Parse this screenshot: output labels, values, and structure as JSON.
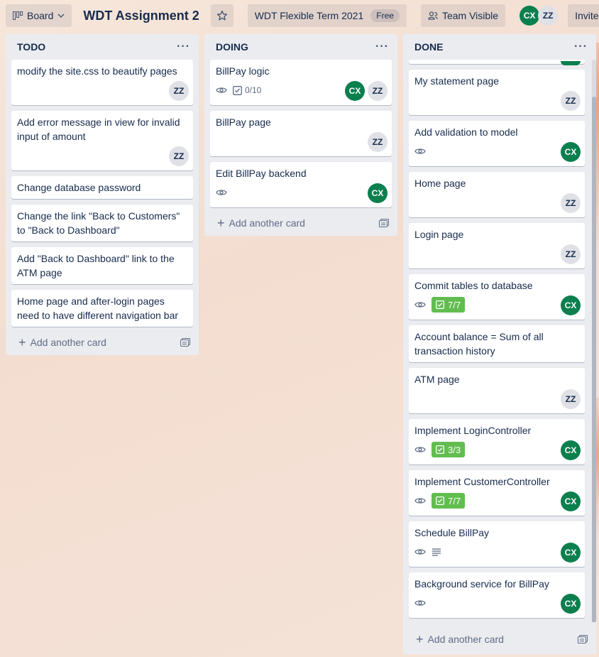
{
  "header": {
    "board_menu_label": "Board",
    "title": "WDT Assignment 2",
    "workspace_label": "WDT Flexible Term 2021",
    "plan_badge": "Free",
    "visibility_label": "Team Visible",
    "members": [
      "CX",
      "ZZ"
    ],
    "invite_label": "Invite"
  },
  "lists": [
    {
      "name": "TODO",
      "add_card_label": "Add another card",
      "cards": [
        {
          "title": "modify the site.css to beautify pages",
          "members": [
            "ZZ"
          ]
        },
        {
          "title": "Add error message in view for invalid input of amount",
          "members": [
            "ZZ"
          ]
        },
        {
          "title": "Change database password",
          "members": []
        },
        {
          "title": "Change the link \"Back to Customers\" to \"Back to Dashboard\"",
          "members": []
        },
        {
          "title": "Add \"Back to Dashboard\" link to the ATM page",
          "members": []
        },
        {
          "title": "Home page and after-login pages need to have different navigation bar",
          "members": []
        }
      ]
    },
    {
      "name": "DOING",
      "add_card_label": "Add another card",
      "cards": [
        {
          "title": "BillPay logic",
          "watch": true,
          "checklist": "0/10",
          "members": [
            "CX",
            "ZZ"
          ]
        },
        {
          "title": "BillPay page",
          "members": [
            "ZZ"
          ]
        },
        {
          "title": "Edit BillPay backend",
          "watch": true,
          "members": [
            "CX"
          ]
        }
      ]
    },
    {
      "name": "DONE",
      "add_card_label": "Add another card",
      "cards": [
        {
          "title": "My statement page",
          "members": [
            "ZZ"
          ]
        },
        {
          "title": "Add validation to model",
          "watch": true,
          "members": [
            "CX"
          ]
        },
        {
          "title": "Home page",
          "members": [
            "ZZ"
          ]
        },
        {
          "title": "Login page",
          "members": [
            "ZZ"
          ]
        },
        {
          "title": "Commit tables to database",
          "watch": true,
          "checklist_done": "7/7",
          "members": [
            "CX"
          ]
        },
        {
          "title": "Account balance = Sum of all transaction history",
          "members": []
        },
        {
          "title": "ATM page",
          "members": [
            "ZZ"
          ]
        },
        {
          "title": "Implement LoginController",
          "watch": true,
          "checklist_done": "3/3",
          "members": [
            "CX"
          ]
        },
        {
          "title": "Implement CustomerController",
          "watch": true,
          "checklist_done": "7/7",
          "members": [
            "CX"
          ]
        },
        {
          "title": "Schedule BillPay",
          "watch": true,
          "description": true,
          "members": [
            "CX"
          ]
        },
        {
          "title": "Background service for BillPay",
          "watch": true,
          "members": [
            "CX"
          ]
        }
      ]
    }
  ],
  "colors": {
    "member_cx": "#0b7f4e",
    "member_zz": "#dfe1e6",
    "checklist_complete": "#61bd4f",
    "list_bg": "#ebecf0"
  }
}
